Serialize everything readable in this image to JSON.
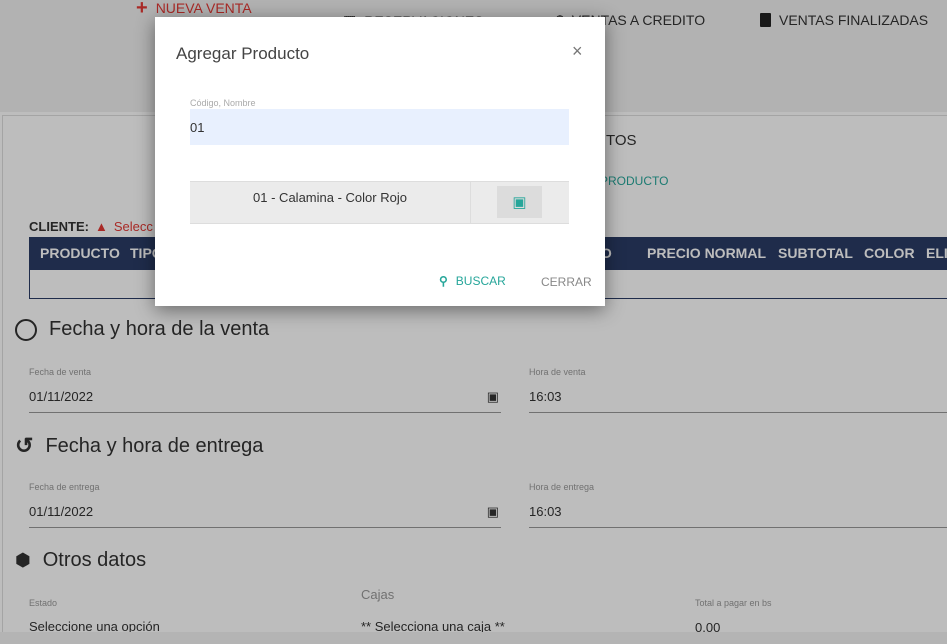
{
  "nav": {
    "items": [
      {
        "label": "NUEVA VENTA",
        "icon": "plus-icon",
        "color": "#e53935"
      },
      {
        "label": "RESERVACIONES",
        "icon": "calendar-icon"
      },
      {
        "label": "VENTAS A CREDITO",
        "icon": "dollar-icon"
      },
      {
        "label": "VENTAS FINALIZADAS",
        "icon": "clipboard-icon"
      }
    ]
  },
  "main": {
    "section_title_fragment": "TOS",
    "add_product_fragment": "PRODUCTO",
    "client_label": "CLIENTE:",
    "client_warning": "Selecc",
    "table_headers": [
      "PRODUCTO",
      "TIPO",
      "IO",
      "PRECIO NORMAL",
      "SUBTOTAL",
      "COLOR",
      "ELIMINAR"
    ],
    "sale_section": {
      "title": "Fecha y hora de la venta",
      "date_label": "Fecha de venta",
      "date_value": "01/11/2022",
      "time_label": "Hora de venta",
      "time_value": "16:03"
    },
    "delivery_section": {
      "title": "Fecha y hora de entrega",
      "date_label": "Fecha de entrega",
      "date_value": "01/11/2022",
      "time_label": "Hora de entrega",
      "time_value": "16:03"
    },
    "other_section": {
      "title": "Otros datos",
      "estado_label": "Estado",
      "estado_value": "Seleccione una opción",
      "cajas_label": "Cajas",
      "cajas_value": "** Selecciona una caja **",
      "total_label": "Total a pagar en bs",
      "total_value": "0.00"
    }
  },
  "modal": {
    "title": "Agregar Producto",
    "close": "×",
    "input_label": "Código, Nombre",
    "input_value": "01",
    "results": [
      {
        "label": "01 - Calamina - Color Rojo",
        "action_icon": "box-open-icon"
      }
    ],
    "search_button": "BUSCAR",
    "close_button": "CERRAR",
    "accent": "#26a69a"
  }
}
